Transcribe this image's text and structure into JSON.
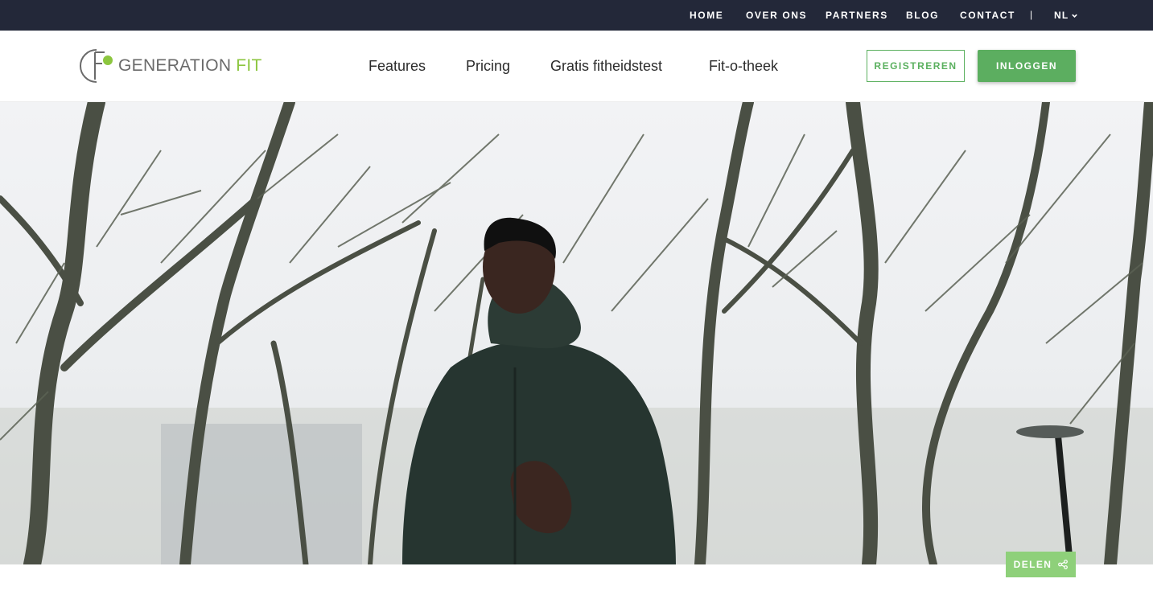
{
  "topbar": {
    "links": [
      "HOME",
      "OVER ONS",
      "PARTNERS",
      "BLOG",
      "CONTACT"
    ],
    "separator": "|",
    "language": "NL",
    "language_icon": "chevron-down-icon"
  },
  "header": {
    "logo_text": "GENERATION",
    "logo_accent": "FIT",
    "nav": [
      "Features",
      "Pricing",
      "Gratis fitheidstest",
      "Fit-o-theek"
    ],
    "register_label": "REGISTREREN",
    "login_label": "INLOGGEN"
  },
  "hero": {
    "share_label": "DELEN",
    "share_icon": "share-icon"
  },
  "colors": {
    "topbar_bg": "#232839",
    "brand_green": "#5cae60",
    "logo_accent": "#8cc63f",
    "share_bg": "#8ed07a"
  }
}
